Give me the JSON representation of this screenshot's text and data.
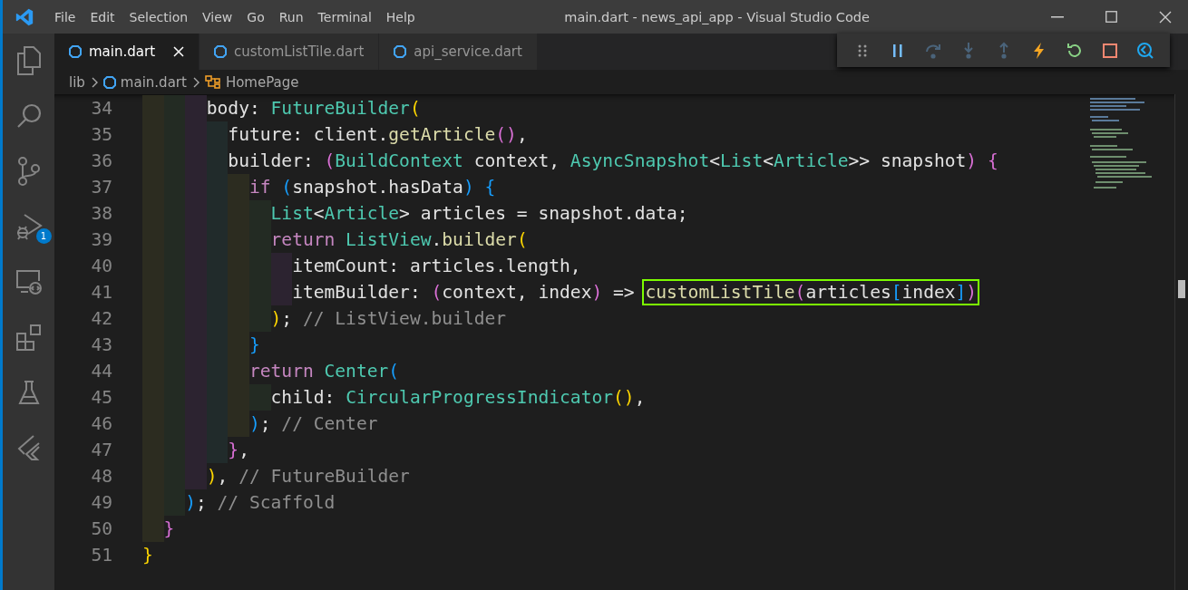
{
  "menu": [
    "File",
    "Edit",
    "Selection",
    "View",
    "Go",
    "Run",
    "Terminal",
    "Help"
  ],
  "window": {
    "title": "main.dart - news_api_app - Visual Studio Code"
  },
  "activity_bar": [
    {
      "kind": "explorer"
    },
    {
      "kind": "search"
    },
    {
      "kind": "source-control"
    },
    {
      "kind": "run-debug",
      "badge": "1"
    },
    {
      "kind": "remote"
    },
    {
      "kind": "extensions"
    },
    {
      "kind": "testing"
    },
    {
      "kind": "flutter"
    }
  ],
  "tabs": [
    {
      "label": "main.dart",
      "selected": true
    },
    {
      "label": "customListTile.dart",
      "selected": false
    },
    {
      "label": "api_service.dart",
      "selected": false
    }
  ],
  "debug_toolbar": [
    {
      "kind": "grip",
      "disabled": false
    },
    {
      "kind": "pause",
      "disabled": false
    },
    {
      "kind": "step-over",
      "disabled": true
    },
    {
      "kind": "step-into",
      "disabled": true
    },
    {
      "kind": "step-out",
      "disabled": true
    },
    {
      "kind": "hot-reload",
      "disabled": false
    },
    {
      "kind": "restart",
      "disabled": false
    },
    {
      "kind": "stop",
      "disabled": false
    },
    {
      "kind": "inspector",
      "disabled": false
    }
  ],
  "breadcrumb": [
    {
      "label": "lib",
      "kind": "folder"
    },
    {
      "label": "main.dart",
      "kind": "file"
    },
    {
      "label": "HomePage",
      "kind": "class"
    }
  ],
  "code": [
    {
      "number": "34",
      "tokens": [
        {
          "text": "      body: ",
          "kind": "plain"
        },
        {
          "text": "FutureBuilder",
          "kind": "type"
        },
        {
          "text": "(",
          "kind": "bracket1"
        }
      ]
    },
    {
      "number": "35",
      "tokens": [
        {
          "text": "        future: client.",
          "kind": "plain"
        },
        {
          "text": "getArticle",
          "kind": "func"
        },
        {
          "text": "()",
          "kind": "bracket2"
        },
        {
          "text": ",",
          "kind": "plain"
        }
      ]
    },
    {
      "number": "36",
      "tokens": [
        {
          "text": "        builder: ",
          "kind": "plain"
        },
        {
          "text": "(",
          "kind": "bracket2"
        },
        {
          "text": "BuildContext",
          "kind": "type"
        },
        {
          "text": " context, ",
          "kind": "plain"
        },
        {
          "text": "AsyncSnapshot",
          "kind": "type"
        },
        {
          "text": "<",
          "kind": "plain"
        },
        {
          "text": "List",
          "kind": "type"
        },
        {
          "text": "<",
          "kind": "plain"
        },
        {
          "text": "Article",
          "kind": "type"
        },
        {
          "text": ">> snapshot",
          "kind": "plain"
        },
        {
          "text": ")",
          "kind": "bracket2"
        },
        {
          "text": " {",
          "kind": "bracket2"
        }
      ]
    },
    {
      "number": "37",
      "tokens": [
        {
          "text": "          if",
          "kind": "keyword"
        },
        {
          "text": " (",
          "kind": "bracket3"
        },
        {
          "text": "snapshot.hasData",
          "kind": "plain"
        },
        {
          "text": ")",
          "kind": "bracket3"
        },
        {
          "text": " {",
          "kind": "bracket3"
        }
      ]
    },
    {
      "number": "38",
      "tokens": [
        {
          "text": "            List",
          "kind": "type"
        },
        {
          "text": "<",
          "kind": "plain"
        },
        {
          "text": "Article",
          "kind": "type"
        },
        {
          "text": "> articles = snapshot.data;",
          "kind": "plain"
        }
      ]
    },
    {
      "number": "39",
      "tokens": [
        {
          "text": "            return",
          "kind": "keyword"
        },
        {
          "text": " ListView",
          "kind": "type"
        },
        {
          "text": ".",
          "kind": "plain"
        },
        {
          "text": "builder",
          "kind": "func"
        },
        {
          "text": "(",
          "kind": "bracket1"
        }
      ]
    },
    {
      "number": "40",
      "tokens": [
        {
          "text": "              itemCount: articles.length,",
          "kind": "plain"
        }
      ]
    },
    {
      "number": "41",
      "tokens": [
        {
          "text": "              itemBuilder: ",
          "kind": "plain"
        },
        {
          "text": "(",
          "kind": "bracket2"
        },
        {
          "text": "context, index",
          "kind": "plain"
        },
        {
          "text": ")",
          "kind": "bracket2"
        },
        {
          "text": " => ",
          "kind": "plain"
        }
      ],
      "boxed_tokens": [
        {
          "text": "customListTile",
          "kind": "func"
        },
        {
          "text": "(",
          "kind": "bracket2"
        },
        {
          "text": "articles",
          "kind": "plain"
        },
        {
          "text": "[",
          "kind": "bracket3"
        },
        {
          "text": "index",
          "kind": "plain"
        },
        {
          "text": "]",
          "kind": "bracket3"
        },
        {
          "text": ")",
          "kind": "bracket2"
        }
      ]
    },
    {
      "number": "42",
      "tokens": [
        {
          "text": "            )",
          "kind": "bracket1"
        },
        {
          "text": "; ",
          "kind": "plain"
        },
        {
          "text": "// ListView.builder",
          "kind": "comment"
        }
      ]
    },
    {
      "number": "43",
      "tokens": [
        {
          "text": "          }",
          "kind": "bracket3"
        }
      ]
    },
    {
      "number": "44",
      "tokens": [
        {
          "text": "          return",
          "kind": "keyword"
        },
        {
          "text": " Center",
          "kind": "type"
        },
        {
          "text": "(",
          "kind": "bracket3"
        }
      ]
    },
    {
      "number": "45",
      "tokens": [
        {
          "text": "            child: ",
          "kind": "plain"
        },
        {
          "text": "CircularProgressIndicator",
          "kind": "type"
        },
        {
          "text": "()",
          "kind": "bracket1"
        },
        {
          "text": ",",
          "kind": "plain"
        }
      ]
    },
    {
      "number": "46",
      "tokens": [
        {
          "text": "          )",
          "kind": "bracket3"
        },
        {
          "text": "; ",
          "kind": "plain"
        },
        {
          "text": "// Center",
          "kind": "comment"
        }
      ]
    },
    {
      "number": "47",
      "tokens": [
        {
          "text": "        }",
          "kind": "bracket2"
        },
        {
          "text": ",",
          "kind": "plain"
        }
      ]
    },
    {
      "number": "48",
      "tokens": [
        {
          "text": "      )",
          "kind": "bracket1"
        },
        {
          "text": ", ",
          "kind": "plain"
        },
        {
          "text": "// FutureBuilder",
          "kind": "comment"
        }
      ]
    },
    {
      "number": "49",
      "tokens": [
        {
          "text": "    )",
          "kind": "bracket3"
        },
        {
          "text": "; ",
          "kind": "plain"
        },
        {
          "text": "// Scaffold",
          "kind": "comment"
        }
      ]
    },
    {
      "number": "50",
      "tokens": [
        {
          "text": "  }",
          "kind": "bracket2"
        }
      ]
    },
    {
      "number": "51",
      "tokens": [
        {
          "text": "}",
          "kind": "bracket1"
        }
      ]
    }
  ]
}
